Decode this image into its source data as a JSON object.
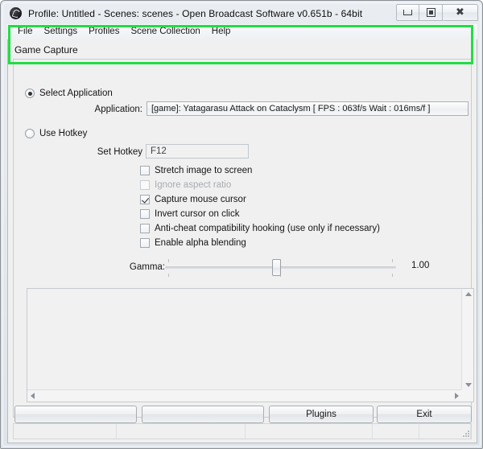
{
  "window": {
    "title": "Profile: Untitled - Scenes: scenes - Open Broadcast Software v0.651b - 64bit",
    "icon": "obs-logo-icon",
    "controls": {
      "minimize": "minimize-icon",
      "maximize": "maximize-icon",
      "close": "close-icon"
    }
  },
  "menubar": {
    "items": [
      {
        "label": "File"
      },
      {
        "label": "Settings"
      },
      {
        "label": "Profiles"
      },
      {
        "label": "Scene Collection"
      },
      {
        "label": "Help"
      }
    ]
  },
  "tab": {
    "label": "Game Capture"
  },
  "capture_mode": {
    "select_application": {
      "label": "Select Application",
      "selected": true
    },
    "use_hotkey": {
      "label": "Use Hotkey",
      "selected": false
    }
  },
  "application": {
    "label": "Application:",
    "value": "[game]: Yatagarasu Attack on Cataclysm [ FPS : 063f/s Wait : 016ms/f ]"
  },
  "hotkey": {
    "label": "Set Hotkey",
    "value": "F12"
  },
  "options": [
    {
      "label": "Stretch image to screen",
      "checked": false,
      "disabled": false
    },
    {
      "label": "Ignore aspect ratio",
      "checked": false,
      "disabled": true
    },
    {
      "label": "Capture mouse cursor",
      "checked": true,
      "disabled": false
    },
    {
      "label": "Invert cursor on click",
      "checked": false,
      "disabled": false
    },
    {
      "label": "Anti-cheat compatibility hooking (use only if necessary)",
      "checked": false,
      "disabled": false
    },
    {
      "label": "Enable alpha blending",
      "checked": false,
      "disabled": false
    }
  ],
  "gamma": {
    "label": "Gamma:",
    "value": "1.00",
    "position_percent": 50
  },
  "preview": {
    "content": "",
    "vertical_scrollbar": "vertical-scrollbar",
    "horizontal_scrollbar": "horizontal-scrollbar"
  },
  "footer": {
    "button_one": "",
    "button_two": "",
    "plugins": "Plugins",
    "exit": "Exit"
  },
  "statusbar": {
    "segments": [
      "",
      "",
      "",
      "",
      ""
    ]
  },
  "colors": {
    "highlight_green": "#22dd44",
    "window_frame": "#dfe4ea",
    "client_bg": "#f0f0f0"
  }
}
